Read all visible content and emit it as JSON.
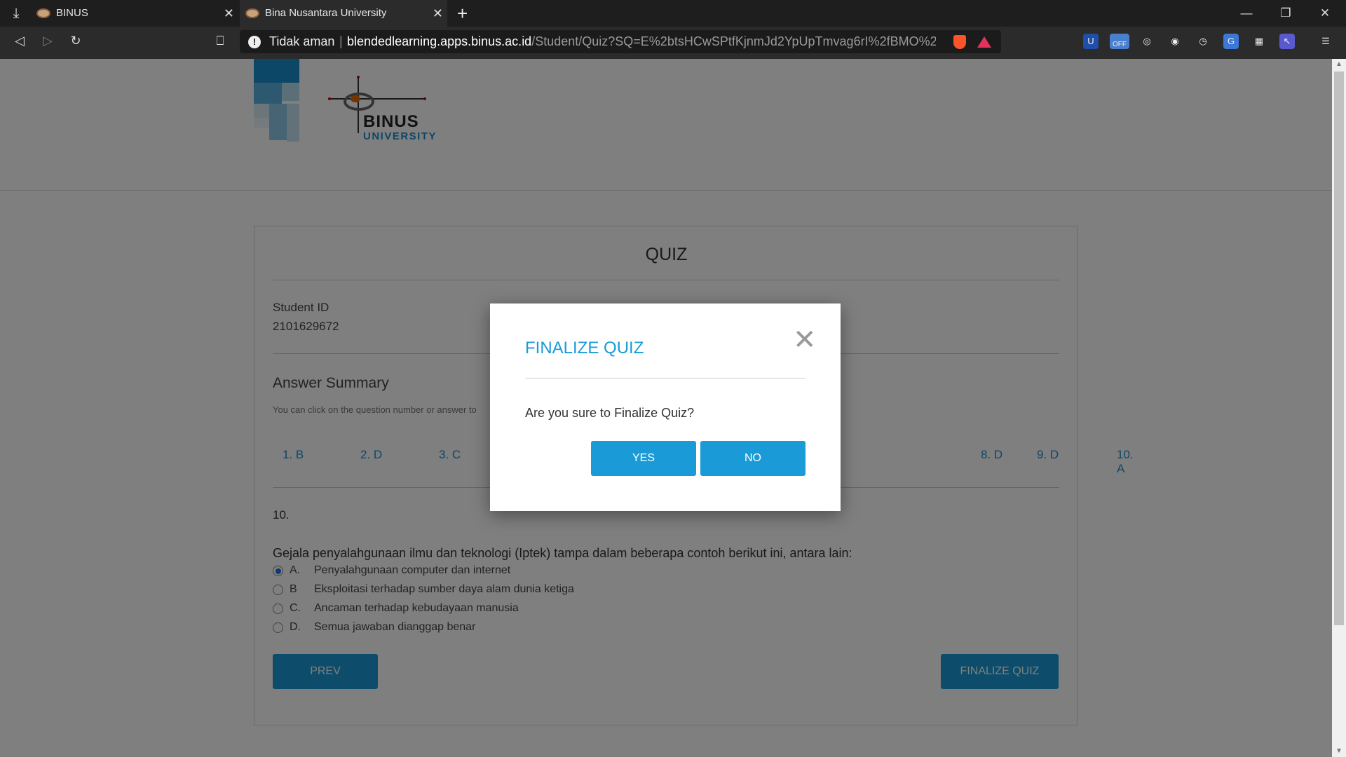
{
  "browser": {
    "tabs": [
      {
        "title": "BINUS",
        "active": false
      },
      {
        "title": "Bina Nusantara University",
        "active": true
      }
    ],
    "security_label": "Tidak aman",
    "url_host": "blendedlearning.apps.binus.ac.id",
    "url_path": "/Student/Quiz?SQ=E%2btsHCwSPtfKjnmJd2YpUpTmvag6rI%2fBMO%2fto...",
    "extension_badge": "OFF"
  },
  "logo": {
    "name": "BINUS",
    "sub": "UNIVERSITY"
  },
  "quiz": {
    "title": "QUIZ",
    "student_id_label": "Student ID",
    "student_id_value": "2101629672",
    "summary_title": "Answer Summary",
    "summary_hint": "You can click on the question number or answer to",
    "answers": [
      "1. B",
      "2. D",
      "3. C",
      "8. D",
      "9. D",
      "10. A"
    ],
    "question_number": "10.",
    "question_text": "Gejala penyalahgunaan ilmu dan teknologi (Iptek) tampa dalam beberapa contoh berikut ini, antara lain:",
    "options": [
      {
        "letter": "A.",
        "text": "Penyalahgunaan computer dan internet",
        "selected": true
      },
      {
        "letter": "B",
        "text": "Eksploitasi terhadap sumber daya alam dunia ketiga",
        "selected": false
      },
      {
        "letter": "C.",
        "text": "Ancaman terhadap kebudayaan manusia",
        "selected": false
      },
      {
        "letter": "D.",
        "text": "Semua jawaban dianggap benar",
        "selected": false
      }
    ],
    "prev_label": "PREV",
    "finalize_label": "FINALIZE QUIZ"
  },
  "modal": {
    "title": "FINALIZE QUIZ",
    "message": "Are you sure to Finalize Quiz?",
    "yes_label": "YES",
    "no_label": "NO"
  },
  "colors": {
    "accent": "#1a9bd7",
    "link": "#1a8fcf",
    "logo_orange": "#e06a00"
  }
}
